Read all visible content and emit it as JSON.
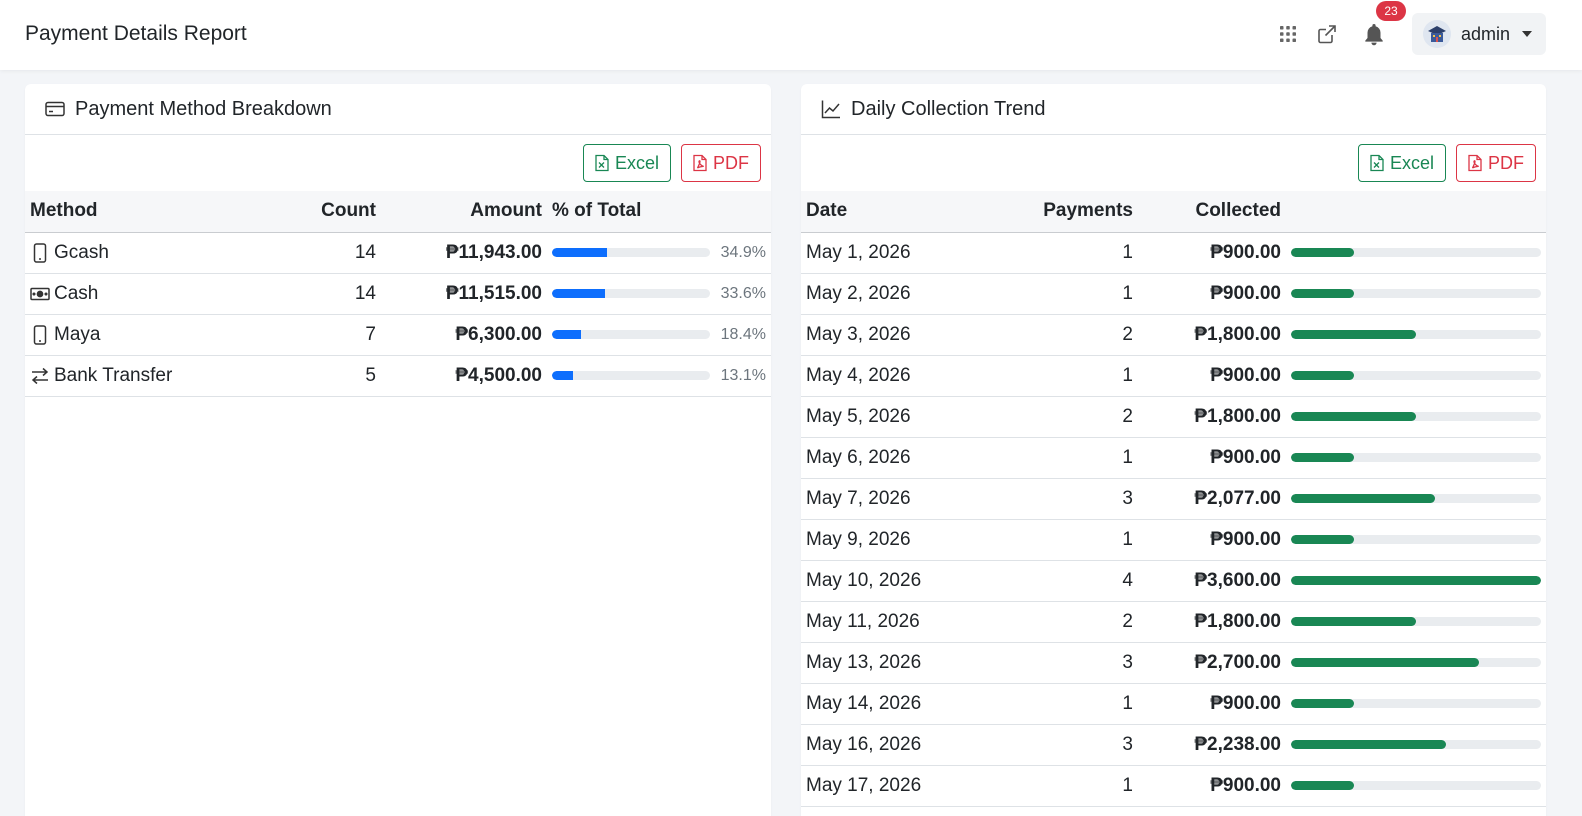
{
  "header": {
    "title": "Payment Details Report",
    "notification_count": "23",
    "user_name": "admin"
  },
  "colors": {
    "primary": "#0d6efd",
    "success": "#198754",
    "danger": "#dc3545"
  },
  "method_card": {
    "title": "Payment Method Breakdown",
    "excel_label": "Excel",
    "pdf_label": "PDF",
    "columns": {
      "method": "Method",
      "count": "Count",
      "amount": "Amount",
      "pct": "% of Total"
    },
    "rows": [
      {
        "icon": "phone-icon",
        "method": "Gcash",
        "count": "14",
        "amount": "₱11,943.00",
        "pct": "34.9%",
        "pct_value": 34.9
      },
      {
        "icon": "cash-icon",
        "method": "Cash",
        "count": "14",
        "amount": "₱11,515.00",
        "pct": "33.6%",
        "pct_value": 33.6
      },
      {
        "icon": "phone-icon",
        "method": "Maya",
        "count": "7",
        "amount": "₱6,300.00",
        "pct": "18.4%",
        "pct_value": 18.4
      },
      {
        "icon": "transfer-arrows-icon",
        "method": "Bank Transfer",
        "count": "5",
        "amount": "₱4,500.00",
        "pct": "13.1%",
        "pct_value": 13.1
      }
    ]
  },
  "trend_card": {
    "title": "Daily Collection Trend",
    "excel_label": "Excel",
    "pdf_label": "PDF",
    "columns": {
      "date": "Date",
      "payments": "Payments",
      "collected": "Collected"
    },
    "max_collected": 3600,
    "rows": [
      {
        "date": "May 1, 2026",
        "payments": "1",
        "collected": "₱900.00",
        "value": 900
      },
      {
        "date": "May 2, 2026",
        "payments": "1",
        "collected": "₱900.00",
        "value": 900
      },
      {
        "date": "May 3, 2026",
        "payments": "2",
        "collected": "₱1,800.00",
        "value": 1800
      },
      {
        "date": "May 4, 2026",
        "payments": "1",
        "collected": "₱900.00",
        "value": 900
      },
      {
        "date": "May 5, 2026",
        "payments": "2",
        "collected": "₱1,800.00",
        "value": 1800
      },
      {
        "date": "May 6, 2026",
        "payments": "1",
        "collected": "₱900.00",
        "value": 900
      },
      {
        "date": "May 7, 2026",
        "payments": "3",
        "collected": "₱2,077.00",
        "value": 2077
      },
      {
        "date": "May 9, 2026",
        "payments": "1",
        "collected": "₱900.00",
        "value": 900
      },
      {
        "date": "May 10, 2026",
        "payments": "4",
        "collected": "₱3,600.00",
        "value": 3600
      },
      {
        "date": "May 11, 2026",
        "payments": "2",
        "collected": "₱1,800.00",
        "value": 1800
      },
      {
        "date": "May 13, 2026",
        "payments": "3",
        "collected": "₱2,700.00",
        "value": 2700
      },
      {
        "date": "May 14, 2026",
        "payments": "1",
        "collected": "₱900.00",
        "value": 900
      },
      {
        "date": "May 16, 2026",
        "payments": "3",
        "collected": "₱2,238.00",
        "value": 2238
      },
      {
        "date": "May 17, 2026",
        "payments": "1",
        "collected": "₱900.00",
        "value": 900
      }
    ]
  }
}
